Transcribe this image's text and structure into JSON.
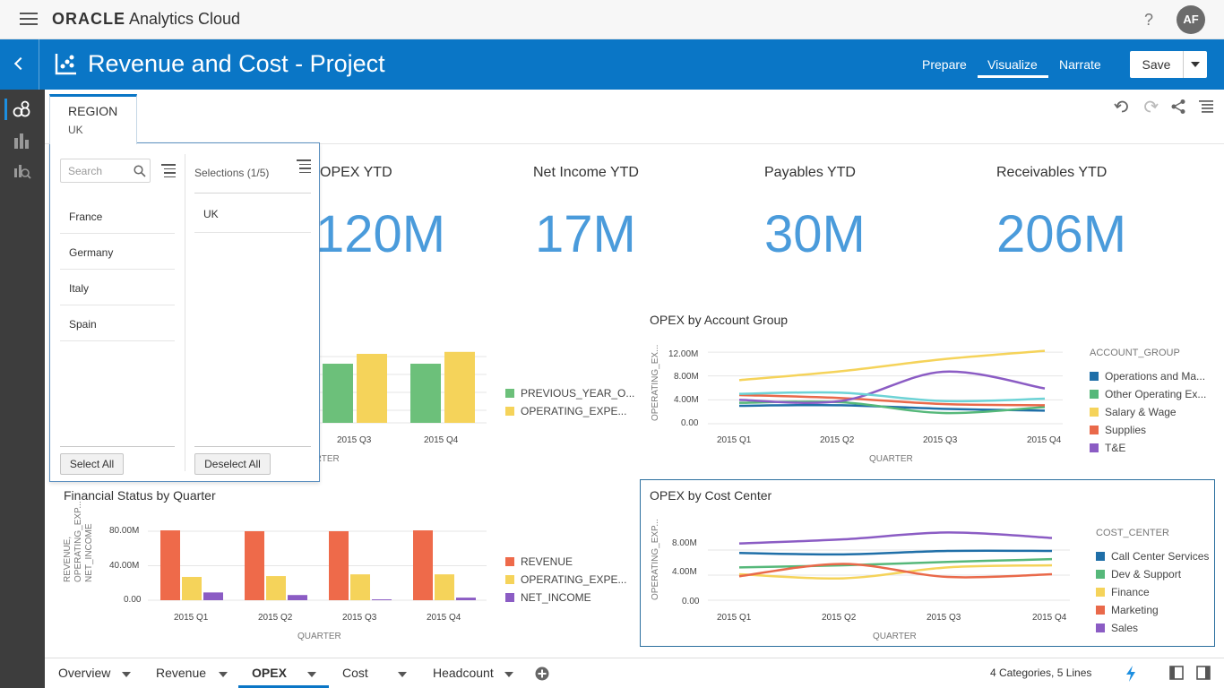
{
  "app": {
    "brand_bold": "ORACLE",
    "brand_rest": " Analytics Cloud",
    "help": "?",
    "avatar": "AF"
  },
  "header": {
    "title": "Revenue and Cost - Project",
    "nav": [
      "Prepare",
      "Visualize",
      "Narrate"
    ],
    "active_nav": "Visualize",
    "save": "Save"
  },
  "filter": {
    "tab_label": "REGION",
    "tab_value": "UK",
    "search_placeholder": "Search",
    "available": [
      "France",
      "Germany",
      "Italy",
      "Spain"
    ],
    "selections_label": "Selections (1/5)",
    "selected": [
      "UK"
    ],
    "select_all": "Select All",
    "deselect_all": "Deselect All"
  },
  "kpis": [
    {
      "title": "OPEX YTD",
      "value": "120M"
    },
    {
      "title": "Net Income YTD",
      "value": "17M"
    },
    {
      "title": "Payables YTD",
      "value": "30M"
    },
    {
      "title": "Receivables YTD",
      "value": "206M"
    }
  ],
  "opex_compare": {
    "categories": [
      "2015 Q3",
      "2015 Q4"
    ],
    "xlabel": "QUARTER",
    "legend": [
      "PREVIOUS_YEAR_O...",
      "OPERATING_EXPE..."
    ],
    "colors": [
      "#6cc07a",
      "#f5d35a"
    ]
  },
  "account_group": {
    "title": "OPEX by Account Group",
    "ylabel": "OPERATING_EX...",
    "xlabel": "QUARTER",
    "yticks": [
      "12.00M",
      "8.00M",
      "4.00M",
      "0.00"
    ],
    "categories": [
      "2015 Q1",
      "2015 Q2",
      "2015 Q3",
      "2015 Q4"
    ],
    "legend_title": "ACCOUNT_GROUP",
    "legend": [
      "Operations and Ma...",
      "Other Operating Ex...",
      "Salary & Wage",
      "Supplies",
      "T&E"
    ],
    "colors": [
      "#1f6fa8",
      "#56b87a",
      "#f5d35a",
      "#e9694a",
      "#8b5cc4"
    ]
  },
  "financial": {
    "title": "Financial Status by Quarter",
    "ylabel_lines": [
      "REVENUE,",
      "OPERATING_EXP...",
      "NET_INCOME"
    ],
    "xlabel": "QUARTER",
    "yticks": [
      "80.00M",
      "40.00M",
      "0.00"
    ],
    "categories": [
      "2015 Q1",
      "2015 Q2",
      "2015 Q3",
      "2015 Q4"
    ],
    "legend": [
      "REVENUE",
      "OPERATING_EXPE...",
      "NET_INCOME"
    ],
    "colors": [
      "#ee6a4a",
      "#f5d35a",
      "#8b5cc4"
    ]
  },
  "cost_center": {
    "title": "OPEX by Cost Center",
    "ylabel": "OPERATING_EXP...",
    "xlabel": "QUARTER",
    "yticks": [
      "8.00M",
      "4.00M",
      "0.00"
    ],
    "categories": [
      "2015 Q1",
      "2015 Q2",
      "2015 Q3",
      "2015 Q4"
    ],
    "legend_title": "COST_CENTER",
    "legend": [
      "Call Center Services",
      "Dev & Support",
      "Finance",
      "Marketing",
      "Sales"
    ],
    "colors": [
      "#1f6fa8",
      "#56b87a",
      "#f5d35a",
      "#e9694a",
      "#8b5cc4"
    ]
  },
  "chart_data": [
    {
      "type": "bar",
      "title": "",
      "categories": [
        "2015 Q3",
        "2015 Q4"
      ],
      "series": [
        {
          "name": "PREVIOUS_YEAR_O...",
          "values": [
            30,
            30
          ]
        },
        {
          "name": "OPERATING_EXPE...",
          "values": [
            35,
            36
          ]
        }
      ],
      "xlabel": "QUARTER"
    },
    {
      "type": "line",
      "title": "OPEX by Account Group",
      "categories": [
        "2015 Q1",
        "2015 Q2",
        "2015 Q3",
        "2015 Q4"
      ],
      "xlabel": "QUARTER",
      "ylabel": "OPERATING_EX...",
      "ylim": [
        0,
        12
      ],
      "series": [
        {
          "name": "Operations and Ma...",
          "values": [
            3.0,
            3.1,
            2.5,
            2.2
          ]
        },
        {
          "name": "Other Operating Ex...",
          "values": [
            3.5,
            3.6,
            1.8,
            2.8
          ]
        },
        {
          "name": "Salary & Wage",
          "values": [
            7.3,
            8.8,
            10.8,
            12.2
          ]
        },
        {
          "name": "Supplies",
          "values": [
            4.8,
            4.3,
            3.3,
            3.1
          ]
        },
        {
          "name": "T&E",
          "values": [
            4.0,
            3.8,
            8.7,
            5.9
          ]
        },
        {
          "name": "",
          "values": [
            5.0,
            5.2,
            3.8,
            4.2
          ]
        }
      ]
    },
    {
      "type": "bar",
      "title": "Financial Status by Quarter",
      "categories": [
        "2015 Q1",
        "2015 Q2",
        "2015 Q3",
        "2015 Q4"
      ],
      "xlabel": "QUARTER",
      "ylim": [
        0,
        80
      ],
      "series": [
        {
          "name": "REVENUE",
          "values": [
            81,
            80,
            80,
            81
          ]
        },
        {
          "name": "OPERATING_EXPE...",
          "values": [
            27,
            28,
            30,
            30
          ]
        },
        {
          "name": "NET_INCOME",
          "values": [
            9,
            6,
            1,
            3
          ]
        }
      ]
    },
    {
      "type": "line",
      "title": "OPEX by Cost Center",
      "categories": [
        "2015 Q1",
        "2015 Q2",
        "2015 Q3",
        "2015 Q4"
      ],
      "xlabel": "QUARTER",
      "ylabel": "OPERATING_EXP...",
      "ylim": [
        0,
        11
      ],
      "series": [
        {
          "name": "Call Center Services",
          "values": [
            6.9,
            6.7,
            7.2,
            7.2
          ]
        },
        {
          "name": "Dev & Support",
          "values": [
            4.8,
            5.1,
            5.6,
            6.0
          ]
        },
        {
          "name": "Finance",
          "values": [
            3.8,
            3.2,
            4.8,
            5.1
          ]
        },
        {
          "name": "Marketing",
          "values": [
            3.5,
            5.3,
            3.4,
            3.8
          ]
        },
        {
          "name": "Sales",
          "values": [
            8.3,
            8.9,
            9.9,
            9.1
          ]
        }
      ]
    }
  ],
  "bottom": {
    "tabs": [
      "Overview",
      "Revenue",
      "OPEX",
      "Cost",
      "Headcount"
    ],
    "active_tab": "OPEX",
    "status": "4 Categories, 5 Lines"
  }
}
